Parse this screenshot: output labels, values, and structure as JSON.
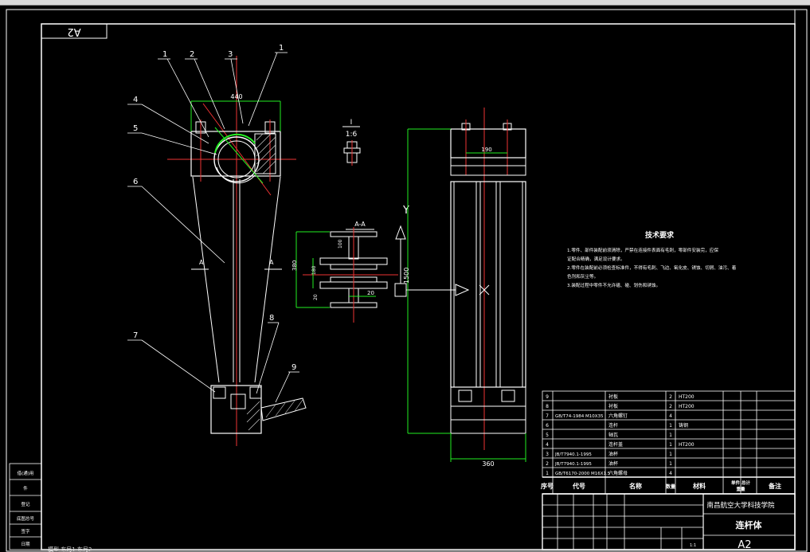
{
  "sheet": {
    "size_label_rotated": "A2",
    "size_label": "A2",
    "scale": "1:1",
    "title": "连杆体",
    "school": "南昌航空大学科技学院"
  },
  "balloons": [
    "1",
    "2",
    "3",
    "1",
    "4",
    "5",
    "6",
    "7",
    "8",
    "9"
  ],
  "dims": {
    "top_width": "440",
    "side_top": "190",
    "side_bottom": "360",
    "overall_height": "1500",
    "section_height": "380",
    "section_mid": "180",
    "section_low": "20",
    "section_web": "100",
    "section_right": "20"
  },
  "section": {
    "title": "A-A",
    "marker_left": "A",
    "marker_right": "A"
  },
  "detail": {
    "label": "I",
    "scale": "1:6"
  },
  "side_view": {
    "axis_label": "Y"
  },
  "tech": {
    "title": "技术要求",
    "lines": [
      "1.零件、部件装配前须清除，严禁在连接件表面有毛刺，零部件安装完，应保",
      "证配合精确，满足设计要求。",
      "2.零件在装配前必须检查标准件，不得有毛刺、飞边、氧化皮、锈蚀、切屑、油污、着",
      "色剂和灰尘等。",
      "3.装配过程中零件不允许磕、碰、划伤和锈蚀。"
    ]
  },
  "bom": {
    "rows": [
      {
        "no": "9",
        "code": "",
        "name": "衬板",
        "qty": "2",
        "material": "HT200"
      },
      {
        "no": "8",
        "code": "",
        "name": "衬板",
        "qty": "2",
        "material": "HT200"
      },
      {
        "no": "7",
        "code": "GB/T74-1984 M10X35",
        "name": "六角螺钉",
        "qty": "4",
        "material": ""
      },
      {
        "no": "6",
        "code": "",
        "name": "连杆",
        "qty": "1",
        "material": "铸钢"
      },
      {
        "no": "5",
        "code": "",
        "name": "轴瓦",
        "qty": "1",
        "material": ""
      },
      {
        "no": "4",
        "code": "",
        "name": "连杆盖",
        "qty": "1",
        "material": "HT200"
      },
      {
        "no": "3",
        "code": "JB/T7940.1-1995",
        "name": "油杯",
        "qty": "1",
        "material": ""
      },
      {
        "no": "2",
        "code": "JB/T7940.1-1995",
        "name": "油杯",
        "qty": "1",
        "material": ""
      },
      {
        "no": "1",
        "code": "GB/T6170-2000 M16X1.5",
        "name": "六角螺母",
        "qty": "4",
        "material": ""
      }
    ],
    "header": {
      "no": "序号",
      "code": "代号",
      "name": "名称",
      "qty": "数量",
      "material": "材料",
      "unit_total": "单件 总计",
      "weight": "重量",
      "remark": "备注"
    }
  },
  "left_strip": [
    "借(通)用",
    "件",
    "登记",
    "底图总号",
    "签字",
    "日期"
  ],
  "bottom_text": "模型 布局1 布局2"
}
